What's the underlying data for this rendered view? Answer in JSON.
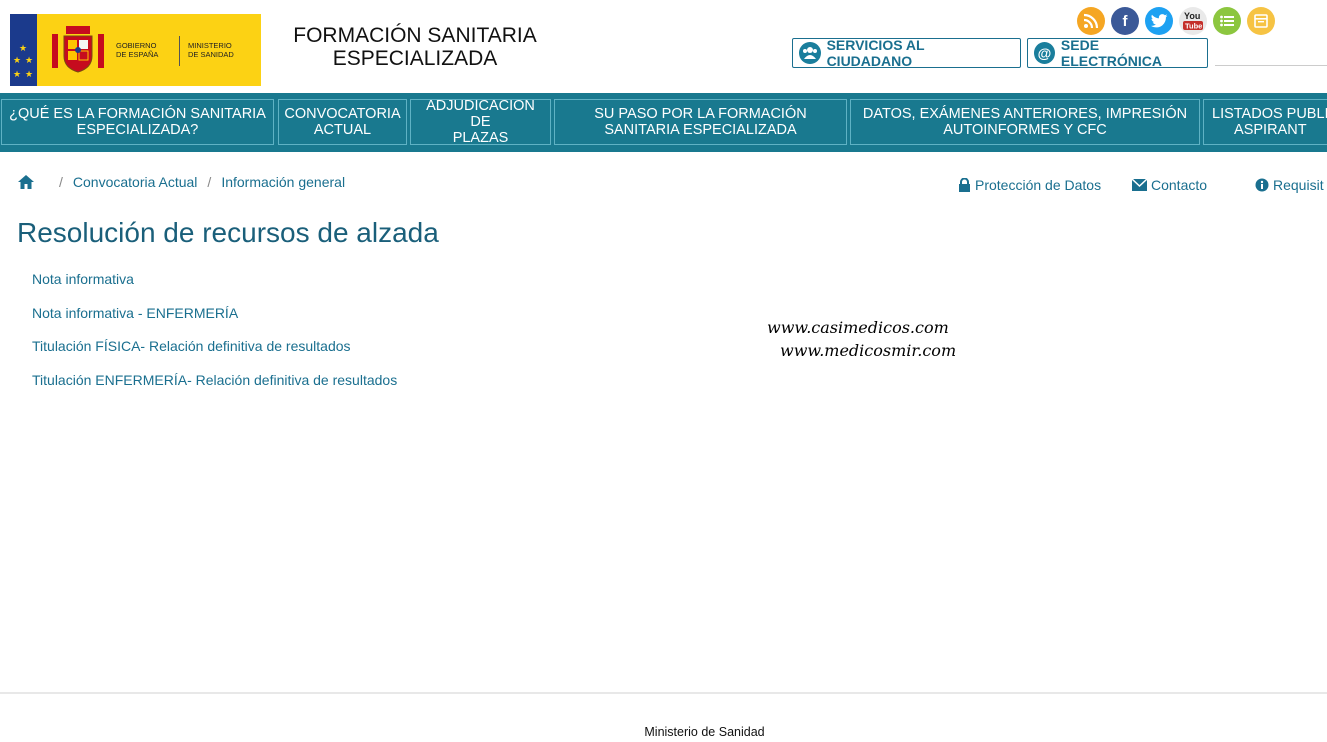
{
  "header": {
    "gov_line1": "GOBIERNO",
    "gov_line2": "DE ESPAÑA",
    "min_line1": "MINISTERIO",
    "min_line2": "DE SANIDAD",
    "title_line1": "FORMACIÓN SANITARIA",
    "title_line2": "ESPECIALIZADA",
    "social_icons": [
      "rss-icon",
      "facebook-icon",
      "twitter-icon",
      "youtube-icon",
      "list-icon",
      "app-icon"
    ],
    "youtube_text": "You\nTube",
    "btn_ciudadano": "SERVICIOS AL CIUDADANO",
    "btn_sede": "SEDE ELECTRÓNICA",
    "sede_symbol": "@"
  },
  "nav": {
    "items": [
      "¿QUÉ ES LA FORMACIÓN SANITARIA ESPECIALIZADA?",
      "CONVOCATORIA ACTUAL",
      "ADJUDICACIÓN DE PLAZAS",
      "SU PASO POR LA FORMACIÓN SANITARIA ESPECIALIZADA",
      "DATOS, EXÁMENES ANTERIORES, IMPRESIÓN AUTOINFORMES Y CFC",
      "LISTADOS PUBLI... ASPIRANT..."
    ],
    "items_display": [
      "¿QUÉ ES LA FORMACIÓN SANITARIA\nESPECIALIZADA?",
      "CONVOCATORIA\nACTUAL",
      "ADJUDICACIÓN DE\nPLAZAS",
      "SU PASO POR LA FORMACIÓN\nSANITARIA ESPECIALIZADA",
      "DATOS, EXÁMENES ANTERIORES, IMPRESIÓN\nAUTOINFORMES Y CFC",
      "LISTADOS PUBLI\nASPIRANT"
    ]
  },
  "breadcrumb": {
    "items": [
      "Convocatoria Actual",
      "Información general"
    ],
    "separator": "/"
  },
  "utils": {
    "proteccion": "Protección de Datos",
    "contacto": "Contacto",
    "requisitos": "Requisit"
  },
  "main": {
    "title": "Resolución de recursos de alzada",
    "links": [
      "Nota informativa",
      "Nota informativa - ENFERMERÍA",
      "Titulación FÍSICA- Relación definitiva de resultados",
      "Titulación ENFERMERÍA- Relación definitiva de resultados"
    ]
  },
  "watermark": {
    "line1": "www.casimedicos.com",
    "line2": "www.medicosmir.com"
  },
  "footer": {
    "text": "Ministerio de Sanidad"
  },
  "colors": {
    "nav_bg": "#19798f",
    "link": "#1a6f8f",
    "logo_yellow": "#fcd214"
  }
}
